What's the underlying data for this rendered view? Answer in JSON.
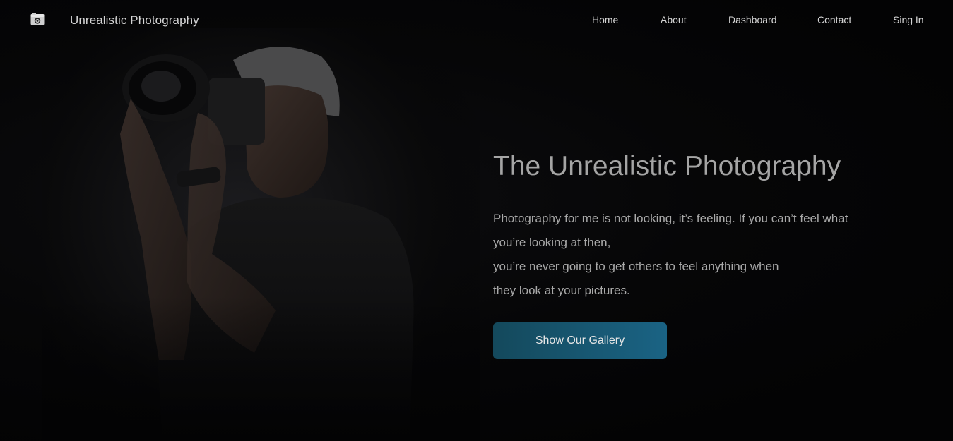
{
  "header": {
    "brand": "Unrealistic Photography",
    "logo_icon": "camera-icon",
    "nav": [
      {
        "label": "Home"
      },
      {
        "label": "About"
      },
      {
        "label": "Dashboard"
      },
      {
        "label": "Contact"
      },
      {
        "label": "Sing In"
      }
    ]
  },
  "hero": {
    "title": "The Unrealistic Photography",
    "text_lines": [
      "Photography for me is not looking, it’s feeling. If you can’t feel what",
      "you’re looking at then,",
      "you’re never going to get others to feel anything when",
      "they look at your pictures."
    ],
    "button_label": "Show Our Gallery",
    "image": "photographer-with-camera"
  },
  "colors": {
    "background": "#030304",
    "button_start": "#14495c",
    "button_end": "#1a6384",
    "title": "#a5a5a5",
    "text": "#a9a9a9"
  }
}
